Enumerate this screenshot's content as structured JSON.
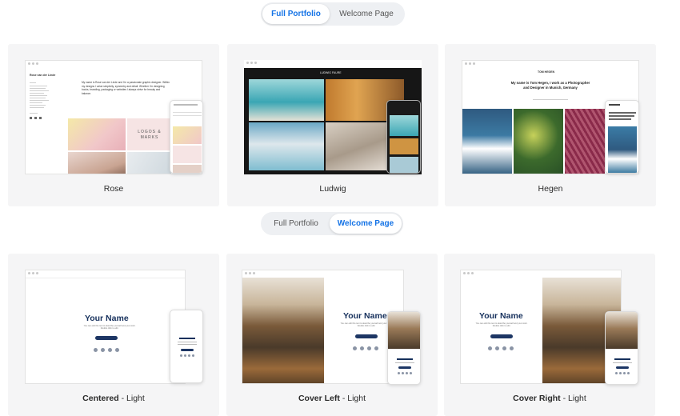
{
  "toggle_top": {
    "full_portfolio": "Full Portfolio",
    "welcome_page": "Welcome Page",
    "active": "full_portfolio"
  },
  "toggle_bottom": {
    "full_portfolio": "Full Portfolio",
    "welcome_page": "Welcome Page",
    "active": "welcome_page"
  },
  "templates_portfolio": [
    {
      "name": "Rose"
    },
    {
      "name": "Ludwig"
    },
    {
      "name": "Hegen"
    }
  ],
  "templates_welcome": [
    {
      "name": "Centered",
      "variant": "Light"
    },
    {
      "name": "Cover Left",
      "variant": "Light"
    },
    {
      "name": "Cover Right",
      "variant": "Light"
    }
  ],
  "previews": {
    "rose_site_title": "Rose van der Linde",
    "rose_intro": "My name is Rose van der Linde and I'm a passionate graphic designer. Within my designs I value simplicity, symmetry and detail. Whether I'm designing books, branding, packaging or websites I always strive for beauty and balance.",
    "rose_tile_text": "LOGOS & MARKS",
    "ludwig_site_title": "LUDWIG FAURE",
    "hegen_site_title": "TOM HEGEN",
    "hegen_intro": "My name is Tom Hegen, I work as a Photographer and Designer in Munich, Germany",
    "your_name": "Your Name",
    "welcome_blurb": "You can edit this text to describe yourself and your work. Double click to edit.",
    "welcome_button": "Edit This Button"
  },
  "colors": {
    "accent": "#1473e6",
    "navy": "#16305c",
    "card_bg": "#f5f5f6"
  }
}
